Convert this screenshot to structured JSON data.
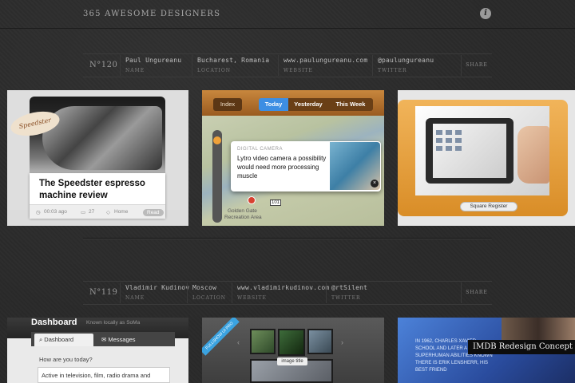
{
  "site": {
    "title": "365 AWESOME DESIGNERS"
  },
  "labels": {
    "name": "NAME",
    "location": "LOCATION",
    "website": "WEBSITE",
    "twitter": "TWITTER",
    "share": "SHARE"
  },
  "designers": [
    {
      "number": "N°120",
      "name": "Paul Ungureanu",
      "location": "Bucharest, Romania",
      "website": "www.paulungureanu.com",
      "twitter": "@paulungureanu",
      "cards": {
        "espresso": {
          "badge": "Speedster",
          "headline": "The Speedster espresso machine review",
          "time": "00:03 ago",
          "comments": "27",
          "home": "Home",
          "read": "Read"
        },
        "news": {
          "index": "Index",
          "tabs": [
            "Today",
            "Yesterday",
            "This Week"
          ],
          "category": "DIGITAL CAMERA",
          "story": "Lytro video camera a possibility would need more processing muscle",
          "place1": "Golden Gate",
          "place2": "Recreation Area",
          "route": "101"
        },
        "square": {
          "label": "Square Register"
        }
      }
    },
    {
      "number": "N°119",
      "name": "Vladimir Kudinov",
      "location": "Moscow",
      "website": "www.vladimirkudinov.com",
      "twitter": "@rtSilent",
      "cards": {
        "dashboard": {
          "title": "Dashboard",
          "known": "Known locally as SoMa",
          "tab1": "Dashboard",
          "tab2": "Messages",
          "question": "How are you today?",
          "answer": "Active in television, film, radio drama and"
        },
        "gallery": {
          "ribbon": "FULLSHOW UI PRO",
          "caption": "image title"
        },
        "imdb": {
          "title": "IMDB Redesign Concept",
          "text": "In 1962, Charles Xavier school and later a superhuman abilities known there is Erik Lensherr, his best friend"
        }
      }
    }
  ]
}
